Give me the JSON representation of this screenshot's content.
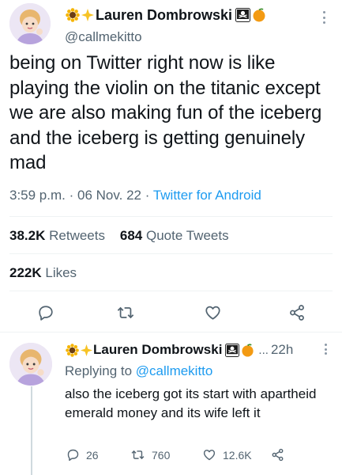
{
  "main_tweet": {
    "author": {
      "display_name": "Lauren Dombrowski",
      "name_prefix_emojis": [
        "sunflower-icon",
        "sparkle-icon"
      ],
      "name_suffix_emojis": [
        "pirate-flag-icon",
        "orange-icon"
      ],
      "handle": "@callmekitto"
    },
    "text": "being on Twitter right now is like playing the violin on the titanic except we are also making fun of the iceberg and the iceberg is getting genuinely mad",
    "time": "3:59 p.m.",
    "separator": "·",
    "date": "06 Nov. 22",
    "source": "Twitter for Android",
    "stats": {
      "retweets_count": "38.2K",
      "retweets_label": "Retweets",
      "quotes_count": "684",
      "quotes_label": "Quote Tweets",
      "likes_count": "222K",
      "likes_label": "Likes"
    },
    "actions": [
      "reply-icon",
      "retweet-icon",
      "like-icon",
      "share-icon"
    ]
  },
  "reply_tweet": {
    "author": {
      "display_name": "Lauren Dombrowski",
      "name_prefix_emojis": [
        "sunflower-icon",
        "sparkle-icon"
      ],
      "name_suffix_emojis": [
        "pirate-flag-icon",
        "orange-icon"
      ]
    },
    "ellipsis": "...",
    "age": "22h",
    "replying_prefix": "Replying to",
    "replying_to": "@callmekitto",
    "text": "also the iceberg got its start with apartheid emerald money and its wife left it",
    "replies": "26",
    "retweets": "760",
    "likes": "12.6K"
  },
  "colors": {
    "text": "#0f1419",
    "secondary": "#536471",
    "link": "#1d9bf0",
    "divider": "#eff3f4",
    "icon": "#536471"
  }
}
